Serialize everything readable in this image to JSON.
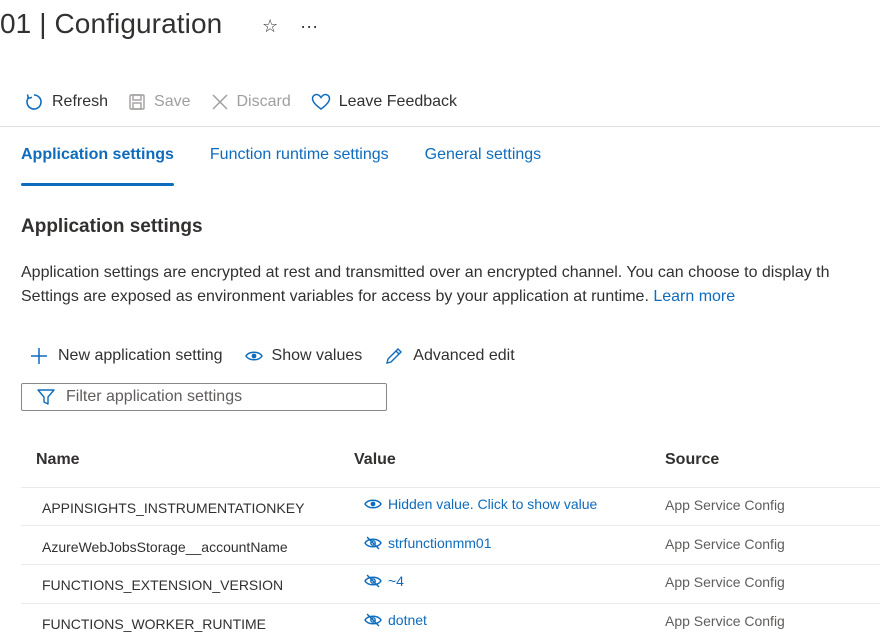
{
  "header": {
    "title": "01 | Configuration",
    "star_icon": "☆",
    "more_icon": "···"
  },
  "toolbar": {
    "refresh": "Refresh",
    "save": "Save",
    "discard": "Discard",
    "feedback": "Leave Feedback"
  },
  "tabs": [
    {
      "label": "Application settings",
      "active": true
    },
    {
      "label": "Function runtime settings",
      "active": false
    },
    {
      "label": "General settings",
      "active": false
    }
  ],
  "section": {
    "title": "Application settings",
    "desc_line1": "Application settings are encrypted at rest and transmitted over an encrypted channel. You can choose to display th",
    "desc_line2": "Settings are exposed as environment variables for access by your application at runtime. ",
    "learn_more": "Learn more"
  },
  "commands": {
    "new": "New application setting",
    "show": "Show values",
    "advanced": "Advanced edit"
  },
  "filter": {
    "placeholder": "Filter application settings"
  },
  "table": {
    "headers": {
      "name": "Name",
      "value": "Value",
      "source": "Source"
    },
    "rows": [
      {
        "name": "APPINSIGHTS_INSTRUMENTATIONKEY",
        "value": "Hidden value. Click to show value",
        "source": "App Service Config",
        "icon": "eye-icon"
      },
      {
        "name": "AzureWebJobsStorage__accountName",
        "value": "strfunctionmm01",
        "source": "App Service Config",
        "icon": "eye-slash-icon"
      },
      {
        "name": "FUNCTIONS_EXTENSION_VERSION",
        "value": "~4",
        "source": "App Service Config",
        "icon": "eye-slash-icon"
      },
      {
        "name": "FUNCTIONS_WORKER_RUNTIME",
        "value": "dotnet",
        "source": "App Service Config",
        "icon": "eye-slash-icon"
      }
    ]
  },
  "colors": {
    "accent": "#0f6cbd",
    "text": "#323130",
    "disabled": "#a19f9d",
    "divider": "#e1dfdd"
  }
}
